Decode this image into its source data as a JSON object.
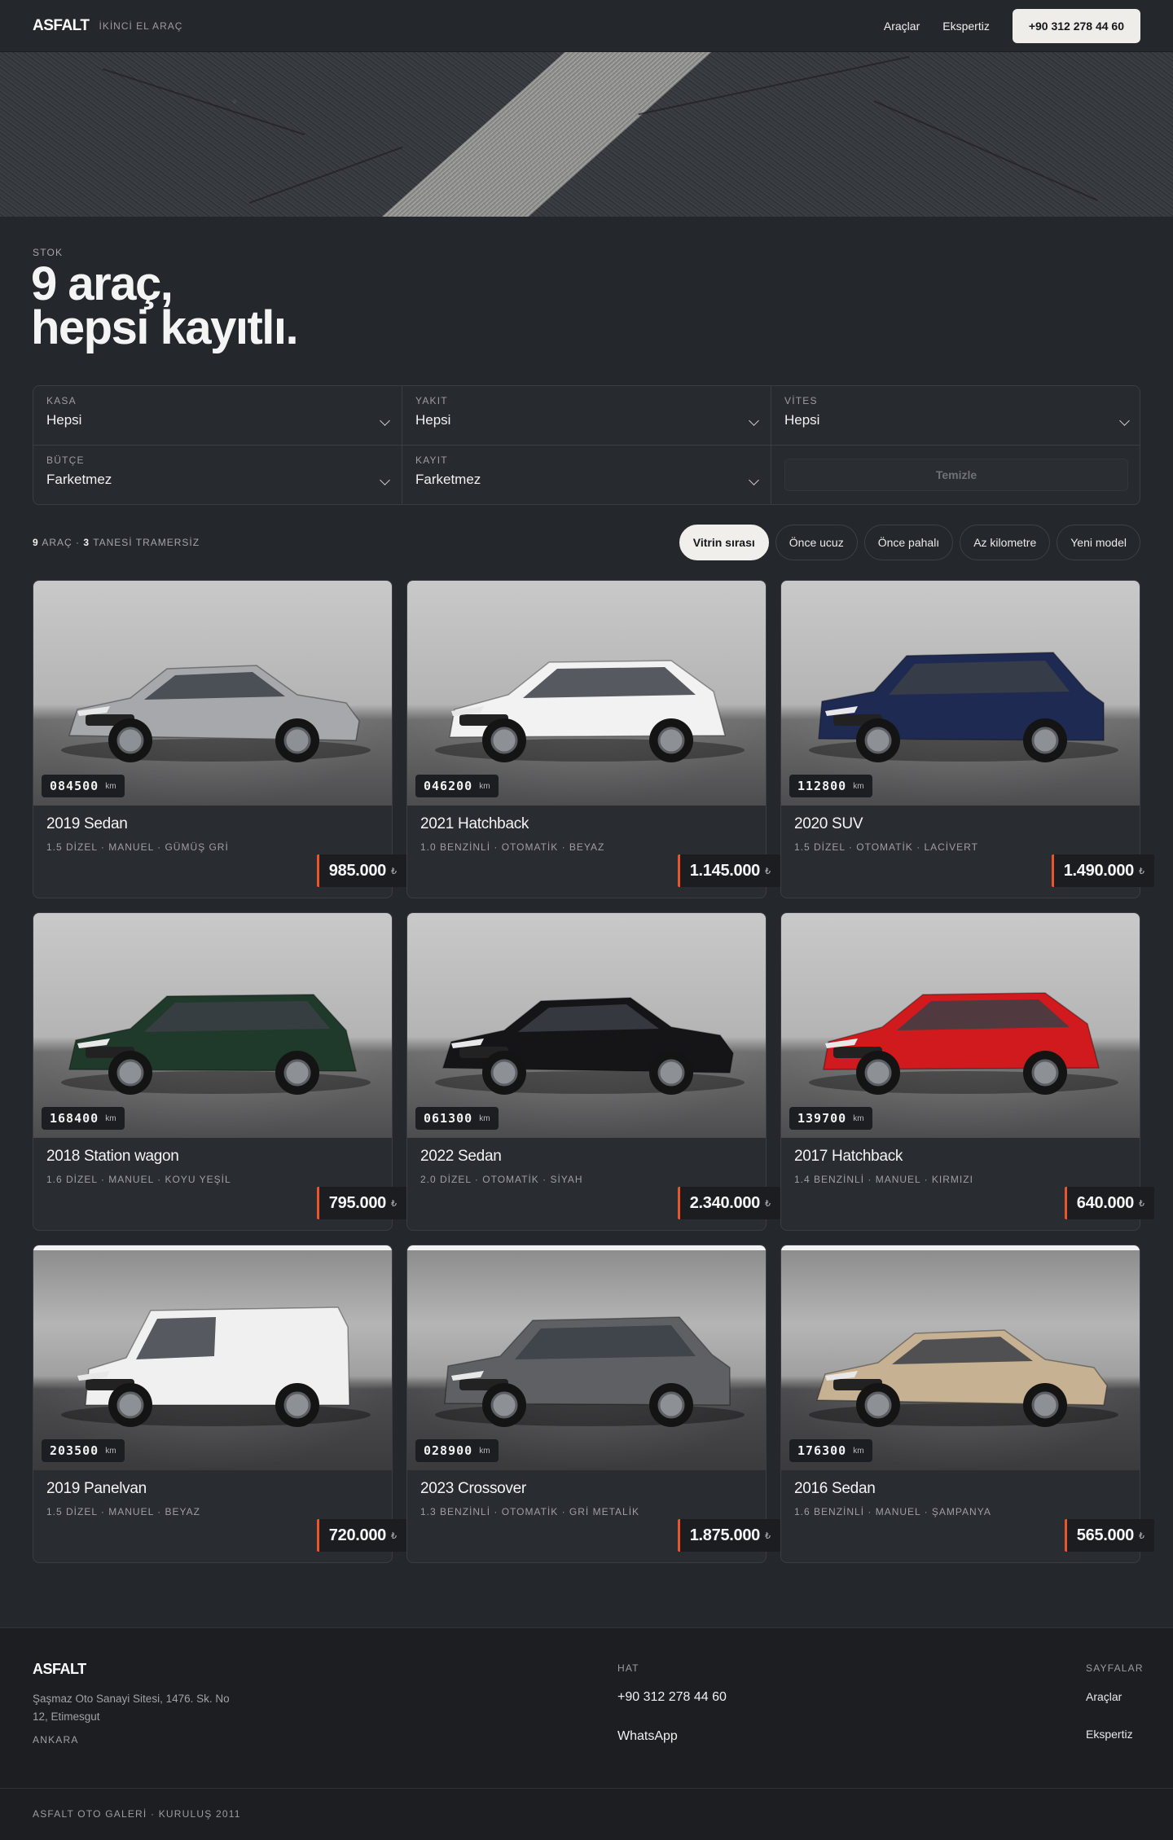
{
  "nav": {
    "logo": "ASFALT",
    "tagline": "İKİNCİ EL ARAÇ",
    "links": [
      "Araçlar",
      "Ekspertiz"
    ],
    "phone_button": "+90 312 278 44 60"
  },
  "stock": {
    "eyebrow": "STOK",
    "headline_line1": "9 araç,",
    "headline_line2": "hepsi kayıtlı."
  },
  "filters": [
    {
      "label": "KASA",
      "value": "Hepsi"
    },
    {
      "label": "YAKIT",
      "value": "Hepsi"
    },
    {
      "label": "VİTES",
      "value": "Hepsi"
    },
    {
      "label": "BÜTÇE",
      "value": "Farketmez"
    },
    {
      "label": "KAYIT",
      "value": "Farketmez"
    }
  ],
  "clear_button": "Temizle",
  "summary": {
    "count": "9",
    "count_label": "ARAÇ ·",
    "no_damage_count": "3",
    "no_damage_label": "TANESİ TRAMERSİZ"
  },
  "sort_options": [
    {
      "label": "Vitrin sırası",
      "active": true
    },
    {
      "label": "Önce ucuz",
      "active": false
    },
    {
      "label": "Önce pahalı",
      "active": false
    },
    {
      "label": "Az kilometre",
      "active": false
    },
    {
      "label": "Yeni model",
      "active": false
    }
  ],
  "km_unit": "km",
  "currency_symbol": "₺",
  "cars": [
    {
      "km": "084500",
      "title": "2019 Sedan",
      "specs": "1.5 DİZEL · MANUEL · GÜMÜŞ GRİ",
      "price": "985.000",
      "color": "#a7a8ab",
      "body": "sedan"
    },
    {
      "km": "046200",
      "title": "2021 Hatchback",
      "specs": "1.0 BENZİNLİ · OTOMATİK · BEYAZ",
      "price": "1.145.000",
      "color": "#f2f2f2",
      "body": "hatchback"
    },
    {
      "km": "112800",
      "title": "2020 SUV",
      "specs": "1.5 DİZEL · OTOMATİK · LACİVERT",
      "price": "1.490.000",
      "color": "#1e2a52",
      "body": "suv"
    },
    {
      "km": "168400",
      "title": "2018 Station wagon",
      "specs": "1.6 DİZEL · MANUEL · KOYU YEŞİL",
      "price": "795.000",
      "color": "#1f3a2b",
      "body": "wagon"
    },
    {
      "km": "061300",
      "title": "2022 Sedan",
      "specs": "2.0 DİZEL · OTOMATİK · SİYAH",
      "price": "2.340.000",
      "color": "#151517",
      "body": "sedan"
    },
    {
      "km": "139700",
      "title": "2017 Hatchback",
      "specs": "1.4 BENZİNLİ · MANUEL · KIRMIZI",
      "price": "640.000",
      "color": "#d11a1e",
      "body": "hatchback"
    },
    {
      "km": "203500",
      "title": "2019 Panelvan",
      "specs": "1.5 DİZEL · MANUEL · BEYAZ",
      "price": "720.000",
      "color": "#f0f0f0",
      "body": "van"
    },
    {
      "km": "028900",
      "title": "2023 Crossover",
      "specs": "1.3 BENZİNLİ · OTOMATİK · GRİ METALİK",
      "price": "1.875.000",
      "color": "#5e6064",
      "body": "suv"
    },
    {
      "km": "176300",
      "title": "2016 Sedan",
      "specs": "1.6 BENZİNLİ · MANUEL · ŞAMPANYA",
      "price": "565.000",
      "color": "#c6b193",
      "body": "sedan"
    }
  ],
  "footer": {
    "logo": "ASFALT",
    "address": "Şaşmaz Oto Sanayi Sitesi, 1476. Sk. No 12, Etimesgut",
    "city": "ANKARA",
    "line_heading": "HAT",
    "phone": "+90 312 278 44 60",
    "whatsapp": "WhatsApp",
    "pages_heading": "SAYFALAR",
    "pages": [
      "Araçlar",
      "Ekspertiz"
    ],
    "copyright": "ASFALT OTO GALERİ · KURULUŞ 2011"
  }
}
